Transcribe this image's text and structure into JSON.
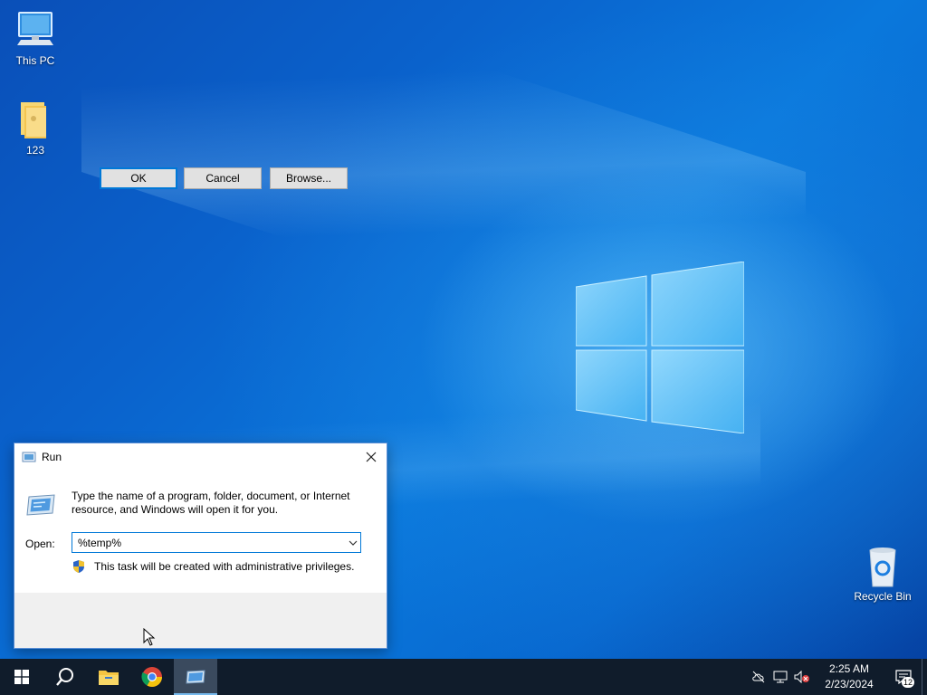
{
  "desktop": {
    "icons": [
      {
        "label": "This PC",
        "icon": "monitor-icon"
      },
      {
        "label": "123",
        "icon": "folder-icon"
      },
      {
        "label": "Recycle Bin",
        "icon": "recycle-bin-icon"
      }
    ]
  },
  "run_dialog": {
    "title": "Run",
    "description": "Type the name of a program, folder, document, or Internet resource, and Windows will open it for you.",
    "open_label": "Open:",
    "open_value": "%temp%",
    "admin_note": "This task will be created with administrative privileges.",
    "buttons": {
      "ok": "OK",
      "cancel": "Cancel",
      "browse": "Browse..."
    }
  },
  "taskbar": {
    "apps": [
      "start-icon",
      "search-icon",
      "file-explorer-icon",
      "chrome-icon",
      "run-icon"
    ],
    "clock": {
      "time": "2:25 AM",
      "date": "2/23/2024"
    },
    "notification_count": "12"
  },
  "colors": {
    "accent": "#0078d7",
    "taskbar": "#101c2b"
  }
}
